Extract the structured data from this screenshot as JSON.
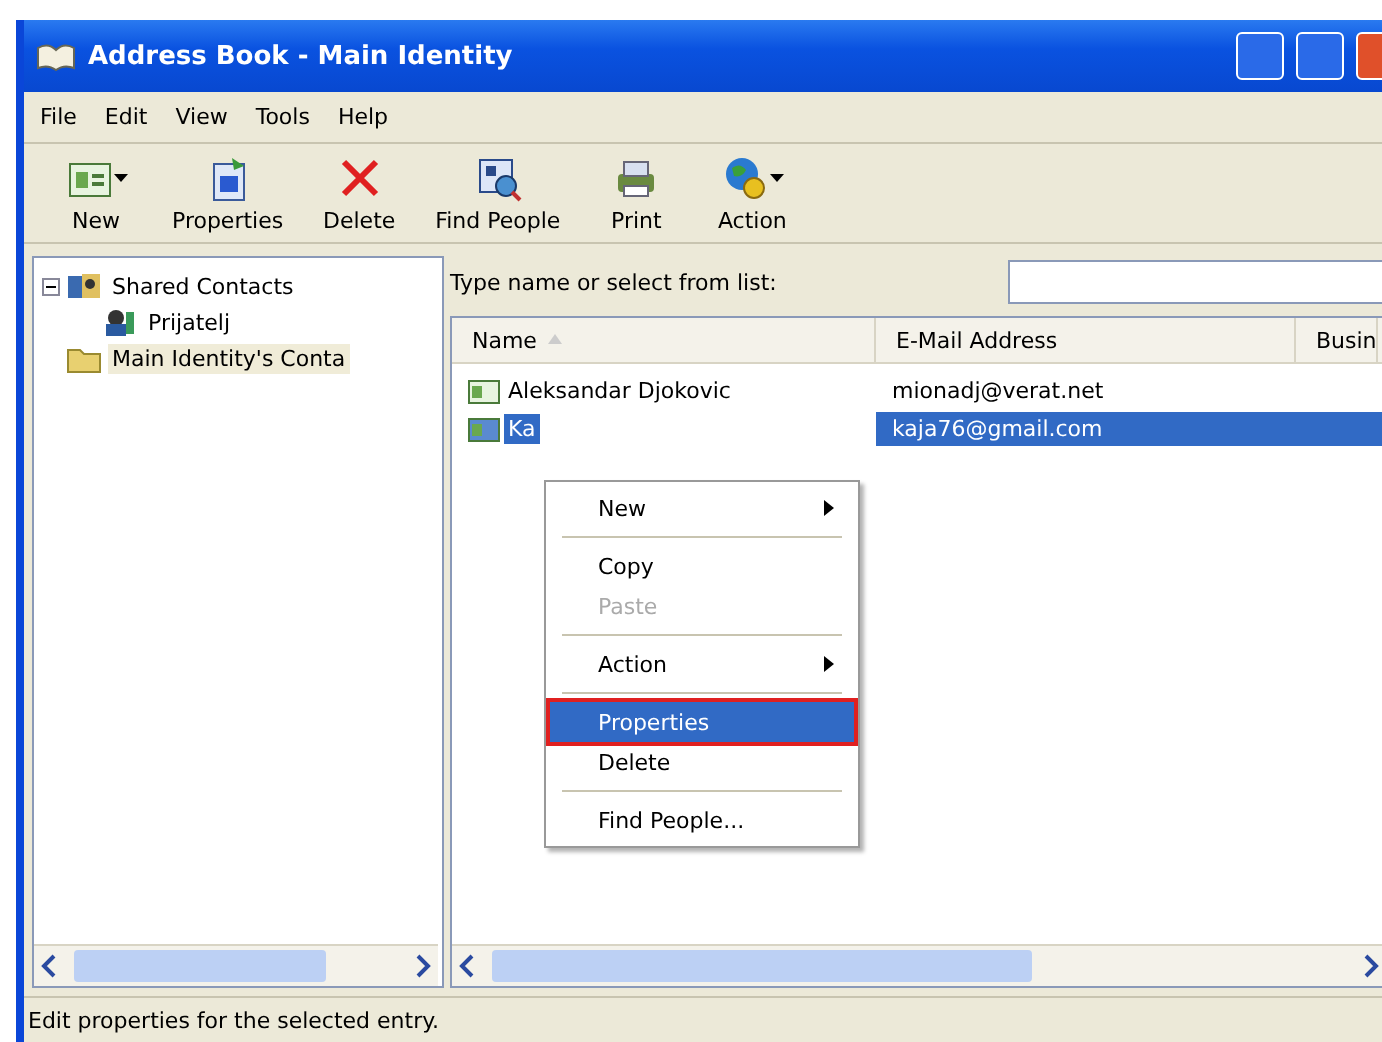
{
  "window": {
    "title": "Address Book - Main Identity"
  },
  "menu_bar": [
    "File",
    "Edit",
    "View",
    "Tools",
    "Help"
  ],
  "toolbar": [
    {
      "label": "New",
      "dropdown": true
    },
    {
      "label": "Properties",
      "dropdown": false
    },
    {
      "label": "Delete",
      "dropdown": false
    },
    {
      "label": "Find People",
      "dropdown": false
    },
    {
      "label": "Print",
      "dropdown": false
    },
    {
      "label": "Action",
      "dropdown": true
    }
  ],
  "tree": [
    {
      "label": "Shared Contacts",
      "expanded": true,
      "selected": false,
      "children": [
        {
          "label": "Prijatelj",
          "selected": false
        }
      ]
    },
    {
      "label": "Main Identity's Conta",
      "selected": true
    }
  ],
  "search": {
    "label": "Type name or select from list:"
  },
  "table": {
    "columns": [
      "Name",
      "E-Mail Address",
      "Busin"
    ],
    "rows": [
      {
        "name": "Aleksandar Djokovic",
        "email": "mionadj@verat.net",
        "selected": false
      },
      {
        "name": "Ka",
        "email": "kaja76@gmail.com",
        "selected": true
      }
    ]
  },
  "context_menu": [
    {
      "kind": "item",
      "label": "New",
      "submenu": true,
      "disabled": false,
      "selected": false
    },
    {
      "kind": "separator"
    },
    {
      "kind": "item",
      "label": "Copy",
      "submenu": false,
      "disabled": false,
      "selected": false
    },
    {
      "kind": "item",
      "label": "Paste",
      "submenu": false,
      "disabled": true,
      "selected": false
    },
    {
      "kind": "separator"
    },
    {
      "kind": "item",
      "label": "Action",
      "submenu": true,
      "disabled": false,
      "selected": false
    },
    {
      "kind": "separator"
    },
    {
      "kind": "item",
      "label": "Properties",
      "submenu": false,
      "disabled": false,
      "selected": true
    },
    {
      "kind": "item",
      "label": "Delete",
      "submenu": false,
      "disabled": false,
      "selected": false
    },
    {
      "kind": "separator"
    },
    {
      "kind": "item",
      "label": "Find People...",
      "submenu": false,
      "disabled": false,
      "selected": false
    }
  ],
  "status_bar": "Edit properties for the selected entry."
}
